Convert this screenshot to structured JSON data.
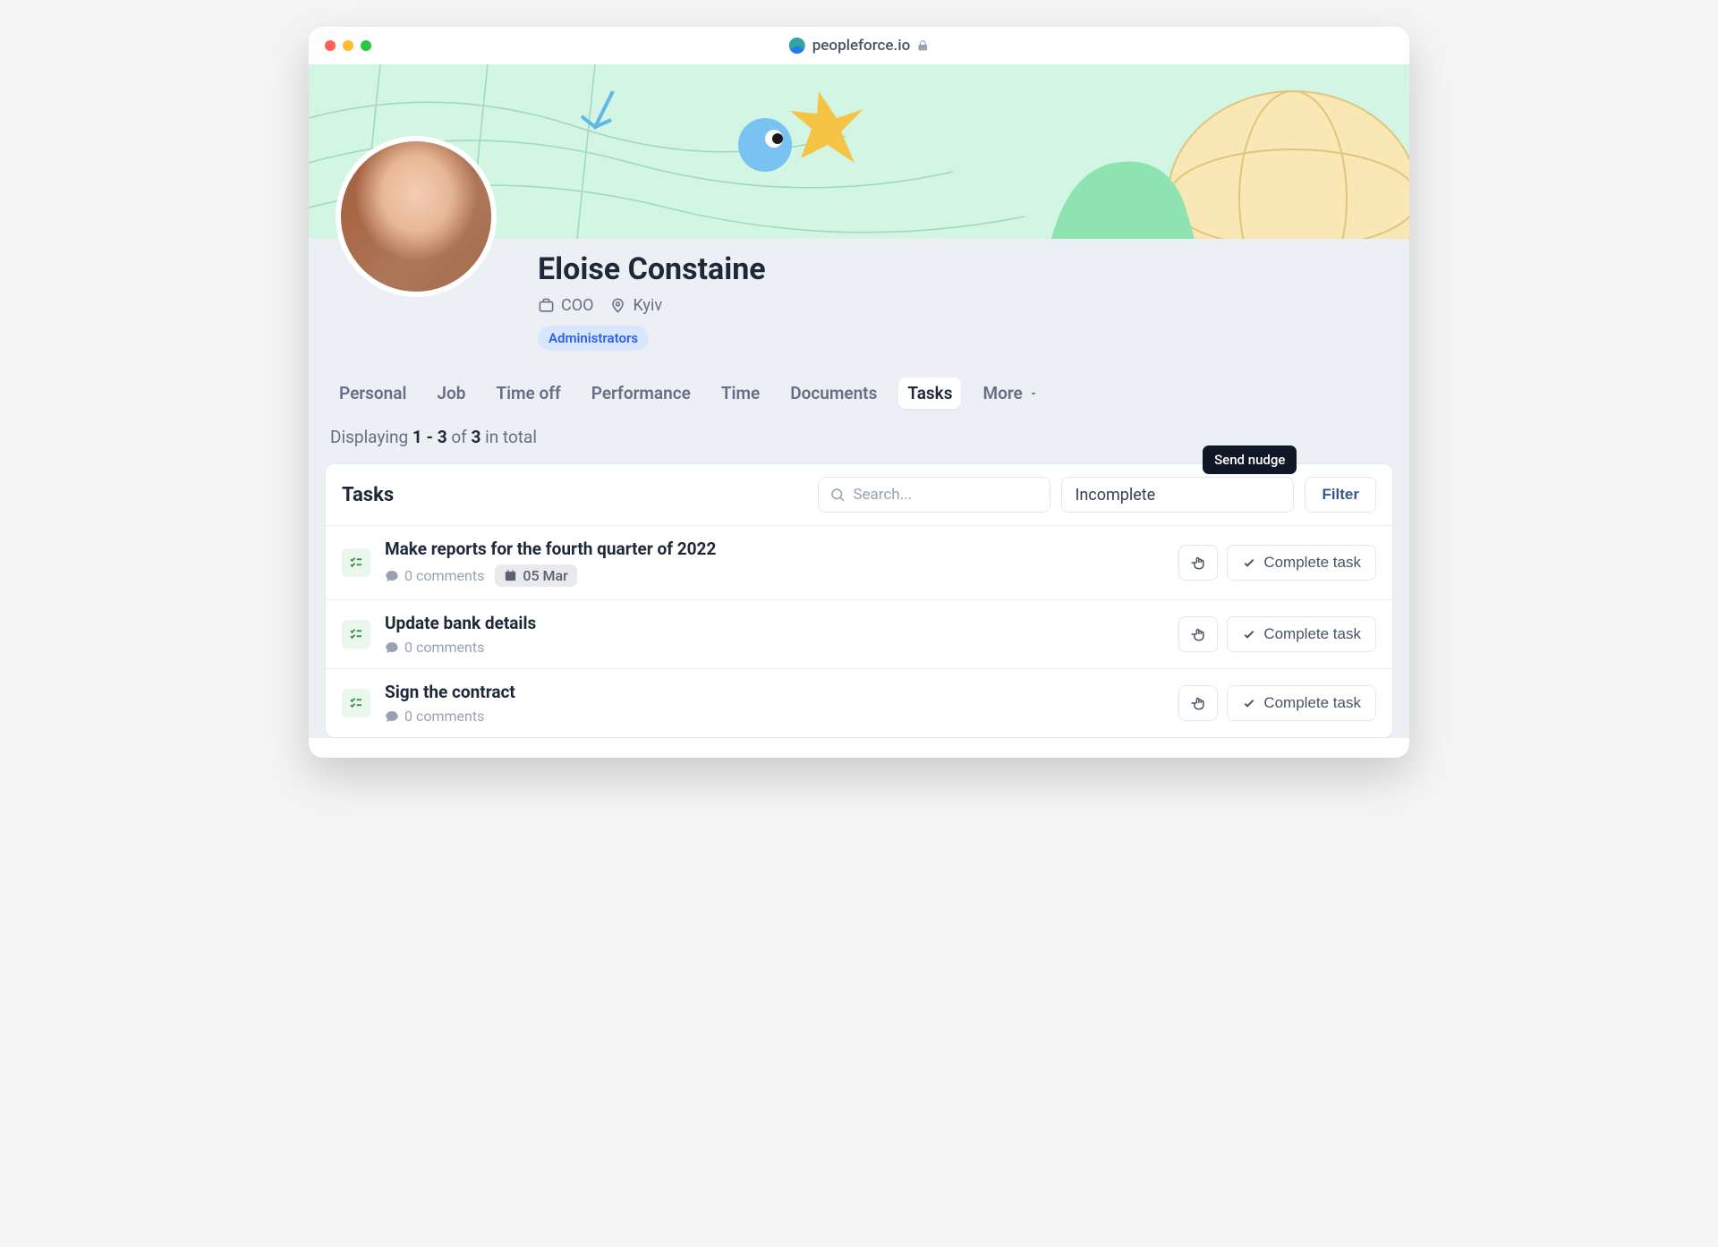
{
  "url": "peopleforce.io",
  "profile": {
    "name": "Eloise Constaine",
    "role": "COO",
    "location": "Kyiv",
    "badge": "Administrators"
  },
  "tabs": [
    "Personal",
    "Job",
    "Time off",
    "Performance",
    "Time",
    "Documents",
    "Tasks",
    "More"
  ],
  "active_tab": "Tasks",
  "displaying": {
    "prefix": "Displaying ",
    "range": "1 - 3",
    "mid": " of ",
    "total": "3",
    "suffix": " in total"
  },
  "tasks_section": {
    "title": "Tasks",
    "search_placeholder": "Search...",
    "status_filter": "Incomplete",
    "filter_label": "Filter",
    "nudge_tooltip": "Send nudge",
    "complete_label": "Complete task"
  },
  "tasks": [
    {
      "title": "Make reports for the fourth quarter of 2022",
      "comments": "0 comments",
      "date": "05 Mar"
    },
    {
      "title": "Update bank details",
      "comments": "0 comments"
    },
    {
      "title": "Sign the contract",
      "comments": "0 comments"
    }
  ]
}
